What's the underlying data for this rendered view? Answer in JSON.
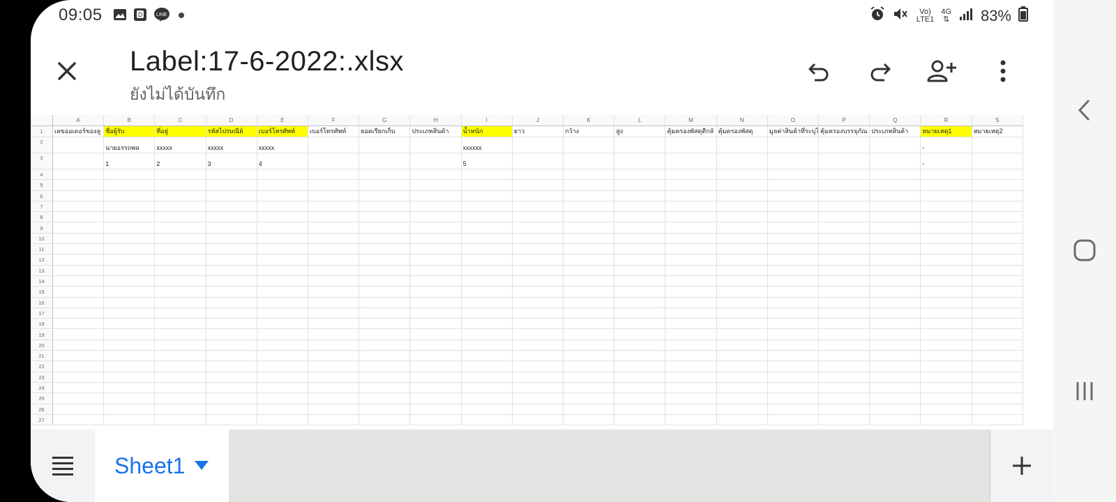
{
  "status_bar": {
    "time": "09:05",
    "battery": "83%",
    "network": "4G",
    "left_icons": [
      "image-icon",
      "reader-app-icon",
      "line-app-icon",
      "dot-icon"
    ],
    "right_icons": [
      "alarm-icon",
      "mute-icon",
      "volte-icon",
      "data-icon",
      "signal-icon",
      "battery-icon"
    ]
  },
  "toolbar": {
    "title": "Label:17-6-2022:.xlsx",
    "status": "ยังไม่ได้บันทึก"
  },
  "sheet": {
    "columns": [
      "A",
      "B",
      "C",
      "D",
      "E",
      "F",
      "G",
      "H",
      "I",
      "J",
      "K",
      "L",
      "M",
      "N",
      "O",
      "P",
      "Q",
      "R",
      "S"
    ],
    "row_numbers": [
      "1",
      "2",
      "3",
      "4",
      "5",
      "6",
      "7",
      "8",
      "9",
      "10",
      "11",
      "12",
      "13",
      "14",
      "15",
      "16",
      "17",
      "18",
      "19",
      "20",
      "21",
      "22",
      "23",
      "24",
      "25",
      "26",
      "27"
    ],
    "row1": [
      "เลขออเดอร์ของลู",
      "ชื่อผู้รับ",
      "ที่อยู่",
      "รหัสไปรษณีย์",
      "เบอร์โทรศัพท์",
      "เบอร์โทรศัพท์",
      "ยอดเรียกเก็บ",
      "ประเภทสินค้า",
      "น้ำหนัก",
      "ยาว",
      "กว้าง",
      "สูง",
      "คุ้มครองพัสดุตีกลั",
      "คุ้มครองพัสดุ",
      "มูลค่าสินค้าที่ระบุไ",
      "คุ้มครองบรรจุภัณ",
      "ประเภทสินค้า",
      "หมายเหตุ1",
      "หมายเหตุ2"
    ],
    "row2": [
      "",
      "นายอรรถพล",
      "xxxxx",
      "xxxxx",
      "xxxxx",
      "",
      "",
      "",
      "xxxxxx",
      "",
      "",
      "",
      "",
      "",
      "",
      "",
      "",
      "-",
      ""
    ],
    "row3": [
      "",
      "1",
      "2",
      "3",
      "4",
      "",
      "",
      "",
      "5",
      "",
      "",
      "",
      "",
      "",
      "",
      "",
      "",
      "-",
      ""
    ],
    "highlight_color": "#ffff00",
    "highlighted_columns": [
      "B",
      "C",
      "D",
      "E",
      "I",
      "R"
    ]
  },
  "bottom_bar": {
    "sheet_tab": "Sheet1",
    "accent": "#1a73e8"
  }
}
